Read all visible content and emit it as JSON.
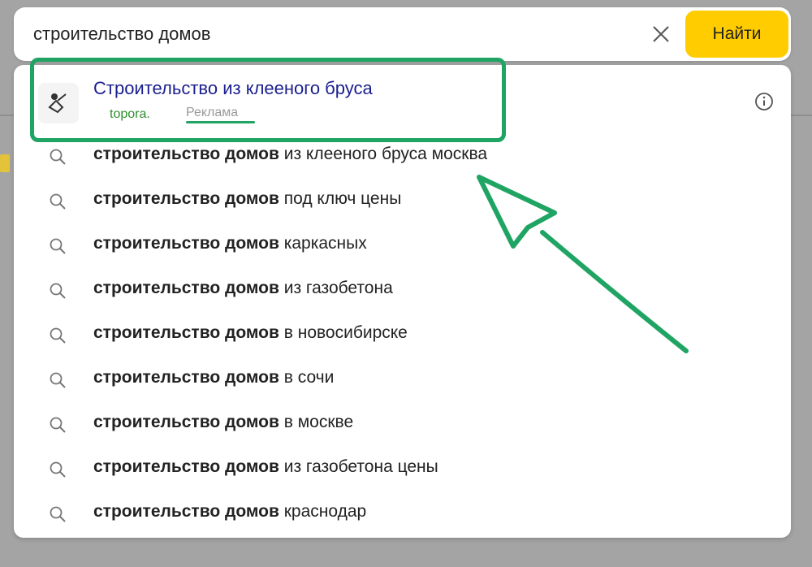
{
  "search": {
    "value": "строительство домов",
    "find_label": "Найти"
  },
  "ad": {
    "title": "Строительство из клееного бруса",
    "domain": "topora.",
    "label": "Реклама"
  },
  "suggestions": [
    {
      "bold": "строительство домов",
      "rest": " из клееного бруса москва"
    },
    {
      "bold": "строительство домов",
      "rest": " под ключ цены"
    },
    {
      "bold": "строительство домов",
      "rest": " каркасных"
    },
    {
      "bold": "строительство домов",
      "rest": " из газобетона"
    },
    {
      "bold": "строительство домов",
      "rest": " в новосибирске"
    },
    {
      "bold": "строительство домов",
      "rest": " в сочи"
    },
    {
      "bold": "строительство домов",
      "rest": " в москве"
    },
    {
      "bold": "строительство домов",
      "rest": " из газобетона цены"
    },
    {
      "bold": "строительство домов",
      "rest": " краснодар"
    }
  ],
  "icons": {
    "clear": "close-icon",
    "info": "info-icon",
    "suggestion": "search-icon"
  },
  "colors": {
    "accent": "#ffcc00",
    "ad_title": "#1b1f8f",
    "annotation": "#1fa463"
  }
}
